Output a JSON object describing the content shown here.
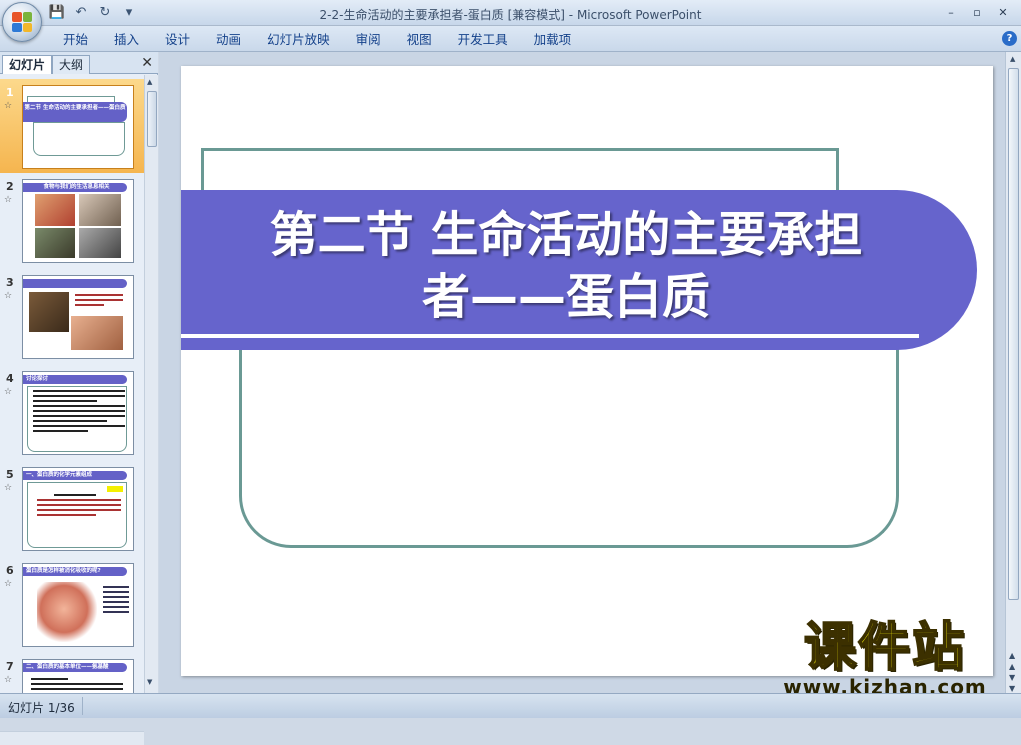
{
  "window": {
    "title": "2-2-生命活动的主要承担者-蛋白质 [兼容模式] - Microsoft PowerPoint",
    "controls": [
      "–",
      "▫",
      "✕"
    ]
  },
  "quick_access": {
    "save": "💾",
    "undo": "↶",
    "redo": "↻",
    "customize": "▾"
  },
  "ribbon": {
    "tabs": [
      "开始",
      "插入",
      "设计",
      "动画",
      "幻灯片放映",
      "审阅",
      "视图",
      "开发工具",
      "加载项"
    ],
    "help": "?"
  },
  "left_panel": {
    "tabs": [
      "幻灯片",
      "大纲"
    ],
    "close": "✕",
    "thumbnails": [
      {
        "num": "1",
        "star": "☆",
        "banner": "第二节 生命活动的主要承担者——蛋白质"
      },
      {
        "num": "2",
        "star": "☆",
        "banner": "食物与我们的生活息息相关"
      },
      {
        "num": "3",
        "star": "☆",
        "banner": ""
      },
      {
        "num": "4",
        "star": "☆",
        "banner": "讨论探讨"
      },
      {
        "num": "5",
        "star": "☆",
        "banner": "一、蛋白质的化学元素组成"
      },
      {
        "num": "6",
        "star": "☆",
        "banner": "蛋白质是怎样被消化吸收的呢?"
      },
      {
        "num": "7",
        "star": "☆",
        "banner": "二、蛋白质的基本单位——氨基酸"
      }
    ]
  },
  "slide": {
    "title_line1": "第二节 生命活动的主要承担",
    "title_line2": "者——蛋白质"
  },
  "status": {
    "slide_counter": "幻灯片 1/36"
  },
  "watermark": {
    "text": "课件站",
    "url": "www.kjzhan.com"
  },
  "colors": {
    "banner": "#6664cc",
    "frame": "#6a9994",
    "selected_thumb": "#f5b54f"
  }
}
